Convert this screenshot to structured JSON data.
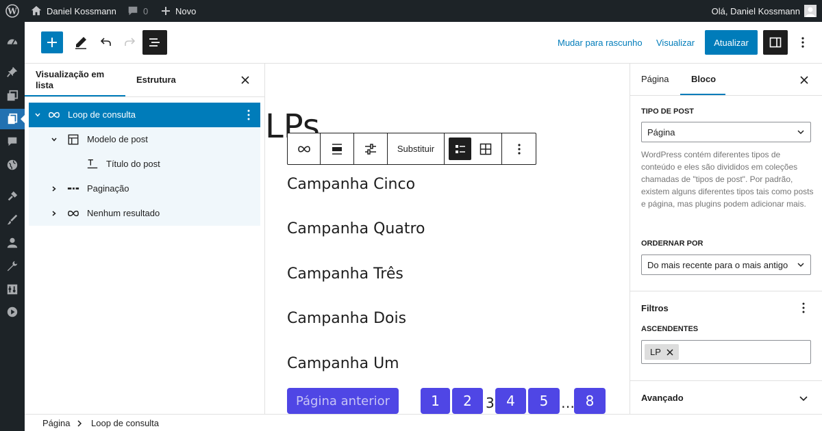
{
  "admin_bar": {
    "site_name": "Daniel Kossmann",
    "comments_count": "0",
    "new_label": "Novo",
    "greeting": "Olá, Daniel Kossmann"
  },
  "toolbar": {
    "switch_to_draft": "Mudar para rascunho",
    "preview": "Visualizar",
    "update": "Atualizar"
  },
  "list_view": {
    "tab_list": "Visualização em lista",
    "tab_structure": "Estrutura",
    "items": [
      {
        "label": "Loop de consulta"
      },
      {
        "label": "Modelo de post"
      },
      {
        "label": "Título do post"
      },
      {
        "label": "Paginação"
      },
      {
        "label": "Nenhum resultado"
      }
    ]
  },
  "canvas": {
    "page_title": "LPs",
    "replace_label": "Substituir",
    "posts": [
      "Campanha Cinco",
      "Campanha Quatro",
      "Campanha Três",
      "Campanha Dois",
      "Campanha Um"
    ],
    "pagination": {
      "previous": "Página anterior",
      "pages": [
        "1",
        "2",
        "3",
        "4",
        "5",
        "…",
        "8"
      ],
      "current": "3"
    }
  },
  "sidebar": {
    "tab_page": "Página",
    "tab_block": "Bloco",
    "post_type_label": "TIPO DE POST",
    "post_type_value": "Página",
    "post_type_help": "WordPress contém diferentes tipos de conteúdo e eles são divididos em coleções chamadas de \"tipos de post\". Por padrão, existem alguns diferentes tipos tais como posts e página, mas plugins podem adicionar mais.",
    "order_label": "ORDERNAR POR",
    "order_value": "Do mais recente para o mais antigo",
    "filters_heading": "Filtros",
    "parents_label": "ASCENDENTES",
    "parent_token": "LP",
    "advanced_heading": "Avançado"
  },
  "breadcrumb": {
    "items": [
      "Página",
      "Loop de consulta"
    ]
  },
  "colors": {
    "admin_dark": "#1d2327",
    "wp_blue": "#007cba",
    "pagination_purple": "#4f46e5"
  }
}
